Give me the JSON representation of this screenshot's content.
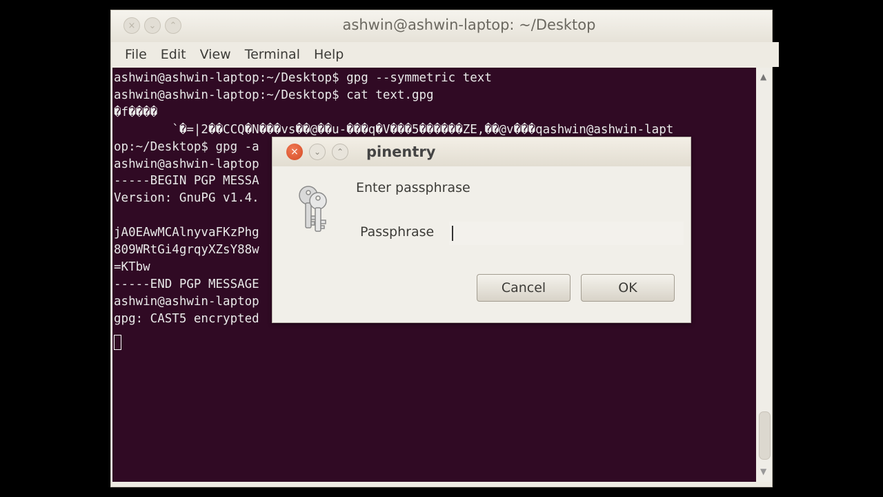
{
  "window": {
    "title": "ashwin@ashwin-laptop: ~/Desktop",
    "controls": {
      "close": "×",
      "minimize": "⌄",
      "maximize": "⌃"
    }
  },
  "menu": [
    "File",
    "Edit",
    "View",
    "Terminal",
    "Help"
  ],
  "terminal": {
    "lines": [
      "ashwin@ashwin-laptop:~/Desktop$ gpg --symmetric text",
      "ashwin@ashwin-laptop:~/Desktop$ cat text.gpg",
      "�f����",
      "        `�=|2��CCQ�N���vs��@��u-���q�V���5������ZE,��@v���qashwin@ashwin-lapt",
      "op:~/Desktop$ gpg -a",
      "ashwin@ashwin-laptop",
      "-----BEGIN PGP MESSA",
      "Version: GnuPG v1.4.",
      "",
      "jA0EAwMCAlnyvaFKzPhg",
      "809WRtGi4grqyXZsY88w",
      "=KTbw",
      "-----END PGP MESSAGE",
      "ashwin@ashwin-laptop",
      "gpg: CAST5 encrypted"
    ]
  },
  "scrollbar": {
    "up": "▲",
    "down": "▼"
  },
  "dialog": {
    "title": "pinentry",
    "controls": {
      "close": "×",
      "minimize": "⌄",
      "maximize": "⌃"
    },
    "description": "Enter passphrase",
    "passphrase_label": "Passphrase",
    "passphrase_value": "",
    "cancel_label": "Cancel",
    "ok_label": "OK",
    "icon": "keys-icon"
  }
}
